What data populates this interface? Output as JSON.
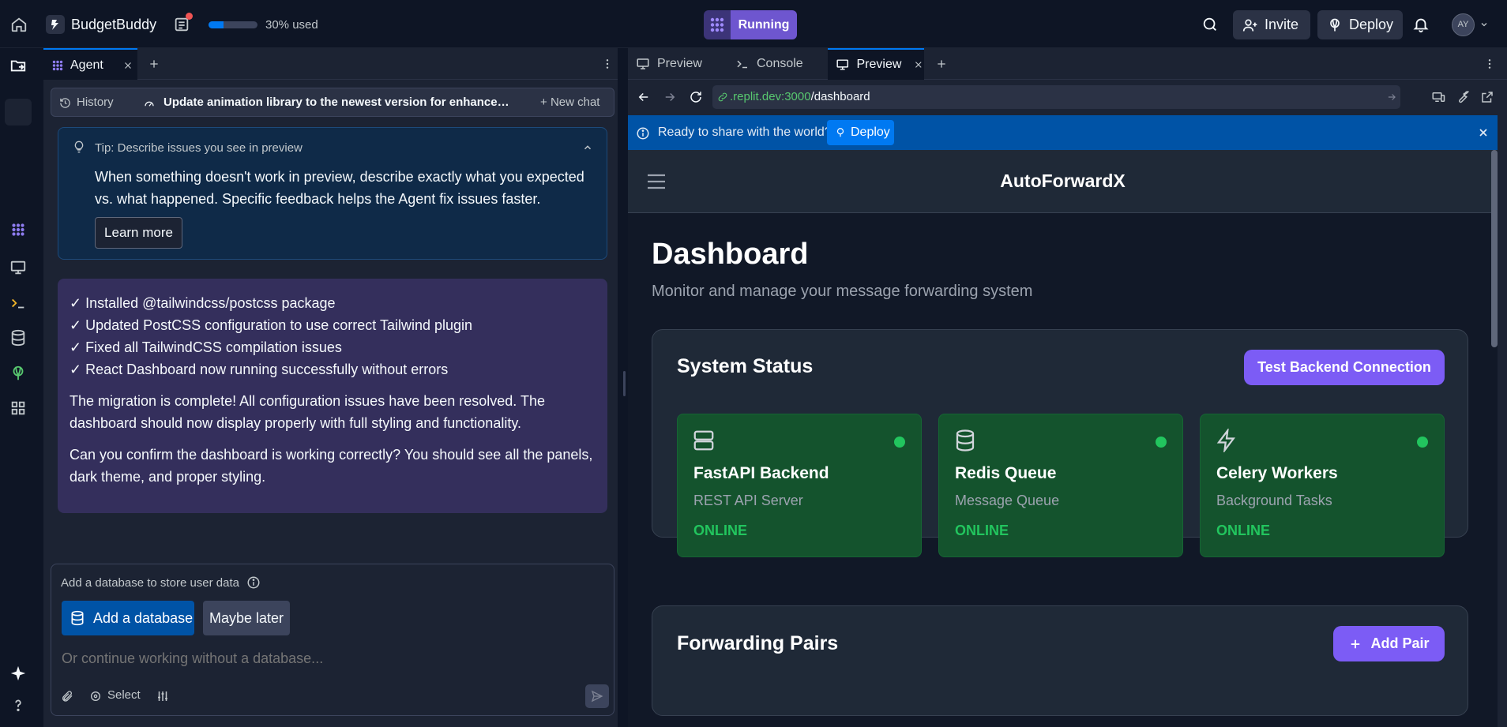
{
  "topbar": {
    "app_name": "BudgetBuddy",
    "usage_text": "30% used",
    "usage_percent": 30,
    "run_label": "Running",
    "invite_label": "Invite",
    "deploy_label": "Deploy",
    "avatar_initials": "AY"
  },
  "left": {
    "agent_tab_label": "Agent",
    "history_label": "History",
    "task_title": "Update animation library to the newest version for enhanced f...",
    "new_chat_label": "New chat",
    "tip": {
      "title": "Tip: Describe issues you see in preview",
      "body": "When something doesn't work in preview, describe exactly what you expected vs. what happened. Specific feedback helps the Agent fix issues faster.",
      "learn_more": "Learn more"
    },
    "message": {
      "items": [
        "✓ Installed @tailwindcss/postcss package",
        "✓ Updated PostCSS configuration to use correct Tailwind plugin",
        "✓ Fixed all TailwindCSS compilation issues",
        "✓ React Dashboard now running successfully without errors"
      ],
      "para1": "The migration is complete! All configuration issues have been resolved. The dashboard should now display properly with full styling and functionality.",
      "para2": "Can you confirm the dashboard is working correctly? You should see all the panels, dark theme, and proper styling."
    },
    "db_prompt": {
      "question": "Add a database to store user data",
      "add_label": "Add a database",
      "later_label": "Maybe later",
      "placeholder": "Or continue working without a database...",
      "select_label": "Select"
    }
  },
  "right": {
    "tabs": [
      "Preview",
      "Console",
      "Preview"
    ],
    "url_host": ".replit.dev:3000",
    "url_path": "/dashboard",
    "banner_text": "Ready to share with the world?",
    "banner_deploy": "Deploy"
  },
  "app": {
    "brand": "AutoForwardX",
    "title": "Dashboard",
    "subtitle": "Monitor and manage your message forwarding system",
    "system_status": {
      "title": "System Status",
      "button": "Test Backend Connection",
      "services": [
        {
          "name": "FastAPI Backend",
          "desc": "REST API Server",
          "status": "ONLINE",
          "icon": "server-icon"
        },
        {
          "name": "Redis Queue",
          "desc": "Message Queue",
          "status": "ONLINE",
          "icon": "database-icon"
        },
        {
          "name": "Celery Workers",
          "desc": "Background Tasks",
          "status": "ONLINE",
          "icon": "zap-icon"
        }
      ]
    },
    "forwarding": {
      "title": "Forwarding Pairs",
      "button": "Add Pair"
    }
  },
  "colors": {
    "accent": "#0079f2",
    "run_purple": "#6e56cf",
    "app_purple": "#7c5cf5",
    "online_green": "#22c55e"
  }
}
